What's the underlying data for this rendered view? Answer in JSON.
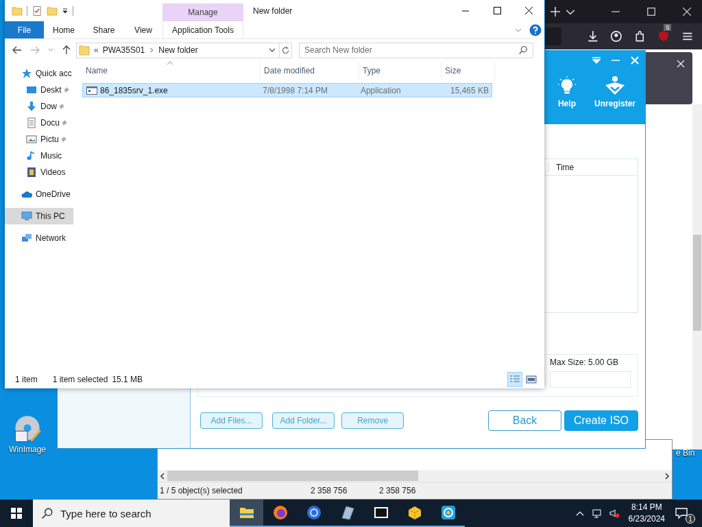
{
  "explorer": {
    "title": "New folder",
    "contextual_group": "Manage",
    "ribbon_tabs": [
      {
        "label": "File",
        "kind": "file"
      },
      {
        "label": "Home",
        "kind": "tab"
      },
      {
        "label": "Share",
        "kind": "tab"
      },
      {
        "label": "View",
        "kind": "tab"
      },
      {
        "label": "Application Tools",
        "kind": "contextual"
      }
    ],
    "address": {
      "overflow": "«",
      "path": [
        "PWA35S01",
        "New folder"
      ]
    },
    "search": {
      "placeholder": "Search New folder"
    },
    "navigation": [
      {
        "label": "Quick acc",
        "kind": "star",
        "selected": false,
        "children": [
          {
            "label": "Deskt",
            "kind": "desktop",
            "pinned": true,
            "selected": false
          },
          {
            "label": "Dow",
            "kind": "download",
            "pinned": true,
            "selected": false
          },
          {
            "label": "Docu",
            "kind": "document",
            "pinned": true,
            "selected": false
          },
          {
            "label": "Pictu",
            "kind": "picture",
            "pinned": true,
            "selected": false
          },
          {
            "label": "Music",
            "kind": "music",
            "pinned": false,
            "selected": false
          },
          {
            "label": "Videos",
            "kind": "video",
            "pinned": false,
            "selected": false
          }
        ]
      },
      {
        "label": "OneDrive",
        "kind": "cloud",
        "selected": false
      },
      {
        "label": "This PC",
        "kind": "pc",
        "selected": true
      },
      {
        "label": "Network",
        "kind": "network",
        "selected": false
      }
    ],
    "columns": [
      "Name",
      "Date modified",
      "Type",
      "Size"
    ],
    "files": [
      {
        "name": "86_1835srv_1.exe",
        "date_modified": "7/8/1998 7:14 PM",
        "type": "Application",
        "size": "15,465 KB",
        "selected": true
      }
    ],
    "status": {
      "item_count": "1 item",
      "selection": "1 item selected",
      "selection_size": "15.1 MB"
    },
    "views": [
      {
        "kind": "details",
        "selected": true
      },
      {
        "kind": "large-icons",
        "selected": false
      }
    ]
  },
  "iso_app": {
    "toolbar": [
      {
        "label": "Help",
        "kind": "help"
      },
      {
        "label": "Unregister",
        "kind": "unregister"
      }
    ],
    "file_list": {
      "columns": [
        "Time"
      ]
    },
    "max_size": "Max Size: 5.00 GB",
    "buttons": [
      {
        "label": "Add Files...",
        "kind": "secondary"
      },
      {
        "label": "Add Folder...",
        "kind": "secondary"
      },
      {
        "label": "Remove",
        "kind": "secondary"
      },
      {
        "label": "Back",
        "kind": "outline"
      },
      {
        "label": "Create ISO",
        "kind": "primary"
      }
    ]
  },
  "browser": {
    "extension_badge": "5"
  },
  "winimage": {
    "status": [
      "1 / 5 object(s) selected",
      "2 358 756",
      "2 358 756"
    ]
  },
  "desktop_icons": [
    {
      "label": "WinImage",
      "kind": "disc"
    },
    {
      "label": "e Bin",
      "kind": "bin"
    }
  ],
  "taskbar": {
    "search_placeholder": "Type here to search",
    "apps": [
      {
        "kind": "explorer",
        "selected": true
      },
      {
        "kind": "firefox",
        "selected": false
      },
      {
        "kind": "chrome",
        "selected": false
      },
      {
        "kind": "winimage",
        "selected": false
      },
      {
        "kind": "sevenzip",
        "selected": false
      },
      {
        "kind": "package",
        "selected": false
      },
      {
        "kind": "app",
        "selected": false
      }
    ],
    "time": "8:14 PM",
    "date": "6/23/2024",
    "notifications": "1"
  }
}
